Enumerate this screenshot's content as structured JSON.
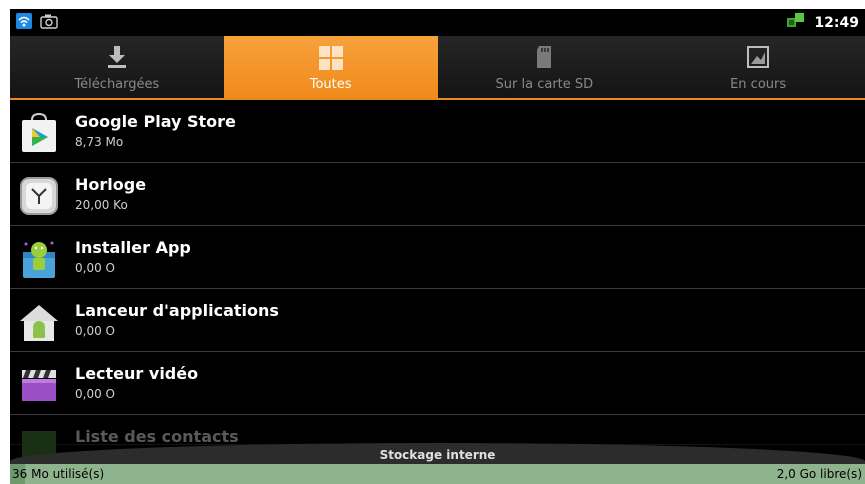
{
  "status_bar": {
    "time": "12:49"
  },
  "tabs": [
    {
      "label": "Téléchargées",
      "icon": "download-icon",
      "selected": false
    },
    {
      "label": "Toutes",
      "icon": "grid-icon",
      "selected": true
    },
    {
      "label": "Sur la carte SD",
      "icon": "sd-card-icon",
      "selected": false
    },
    {
      "label": "En cours",
      "icon": "running-app-icon",
      "selected": false
    }
  ],
  "apps": [
    {
      "name": "Google Play Store",
      "size": "8,73 Mo",
      "icon": "play-store-icon"
    },
    {
      "name": "Horloge",
      "size": "20,00 Ko",
      "icon": "clock-app-icon"
    },
    {
      "name": "Installer App",
      "size": "0,00 O",
      "icon": "installer-app-icon"
    },
    {
      "name": "Lanceur d'applications",
      "size": "0,00 O",
      "icon": "launcher-app-icon"
    },
    {
      "name": "Lecteur vidéo",
      "size": "0,00 O",
      "icon": "video-player-icon"
    },
    {
      "name": "Liste des contacts",
      "size": "",
      "icon": "contacts-icon"
    }
  ],
  "storage": {
    "title": "Stockage interne",
    "used_label": "36 Mo utilisé(s)",
    "free_label": "2,0 Go libre(s)",
    "used_fraction": 0.018
  },
  "colors": {
    "accent": "#f08a1a",
    "storage_bar": "#8fb48d"
  }
}
